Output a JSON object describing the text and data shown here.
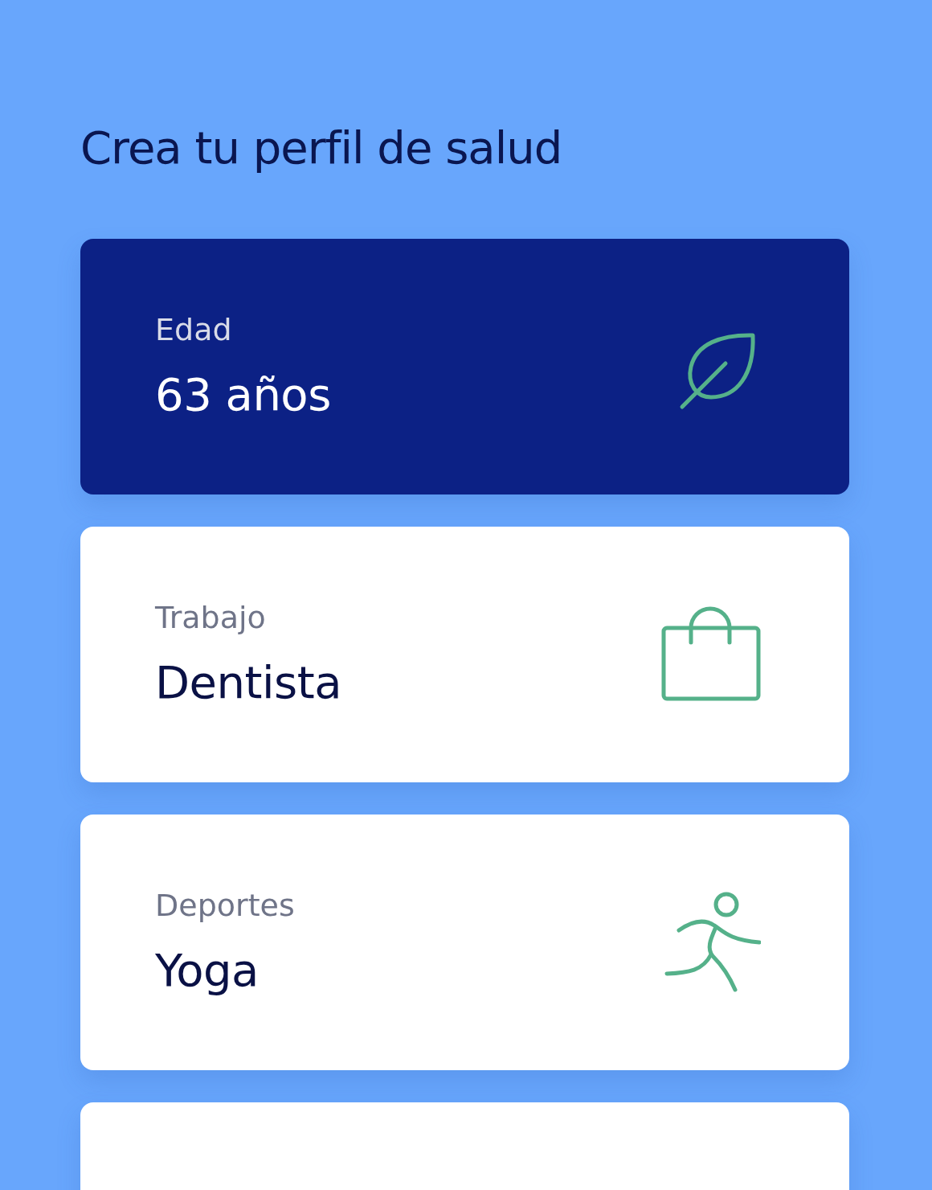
{
  "title": "Crea tu perfil de salud",
  "cards": [
    {
      "label": "Edad",
      "value": "63 años",
      "selected": true
    },
    {
      "label": "Trabajo",
      "value": "Dentista",
      "selected": false
    },
    {
      "label": "Deportes",
      "value": "Yoga",
      "selected": false
    },
    {
      "selected": false
    }
  ]
}
